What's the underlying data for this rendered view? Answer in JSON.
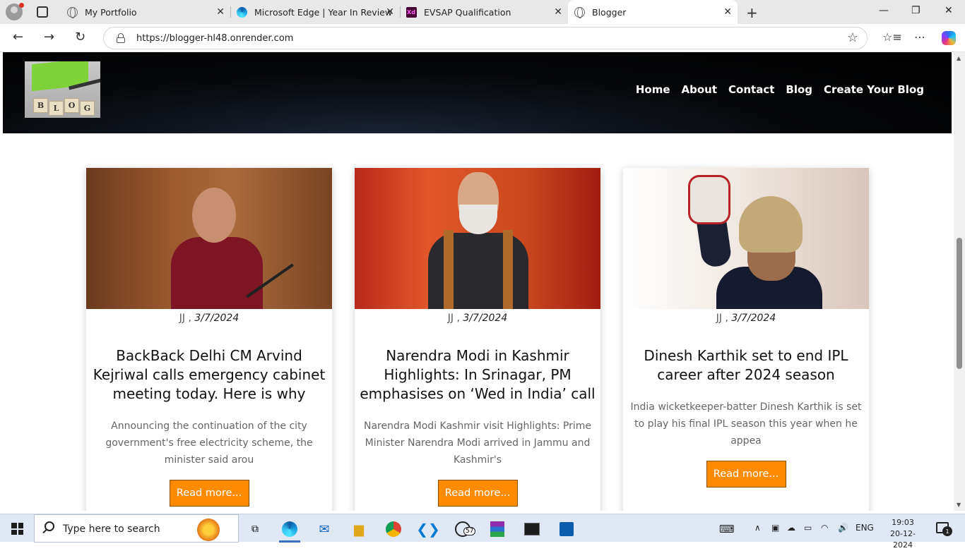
{
  "browser": {
    "tabs": [
      {
        "title": "My Portfolio",
        "icon": "globe-icon"
      },
      {
        "title": "Microsoft Edge | Year In Review",
        "icon": "edge-icon"
      },
      {
        "title": "EVSAP Qualification",
        "icon": "xd-icon",
        "icon_text": "Xd"
      },
      {
        "title": "Blogger",
        "icon": "globe-icon",
        "active": true
      }
    ],
    "url": "https://blogger-hl48.onrender.com"
  },
  "site": {
    "logo_letters": [
      "B",
      "L",
      "O",
      "G"
    ],
    "nav": [
      "Home",
      "About",
      "Contact",
      "Blog",
      "Create Your Blog"
    ]
  },
  "posts": [
    {
      "author": "JJ",
      "separator": " , ",
      "date": "3/7/2024",
      "title": "BackBack Delhi CM Arvind Kejriwal calls emergency cabinet meeting today. Here is why",
      "excerpt": "Announcing the continuation of the city government's free electricity scheme, the minister said arou",
      "button": "Read more..."
    },
    {
      "author": "JJ",
      "separator": " , ",
      "date": "3/7/2024",
      "title": "Narendra Modi in Kashmir Highlights: In Srinagar, PM emphasises on ‘Wed in India’ call",
      "excerpt": "Narendra Modi Kashmir visit Highlights: Prime Minister Narendra Modi arrived in Jammu and Kashmir's",
      "button": "Read more..."
    },
    {
      "author": "JJ",
      "separator": " , ",
      "date": "3/7/2024",
      "title": "Dinesh Karthik set to end IPL career after 2024 season",
      "excerpt": "India wicketkeeper-batter Dinesh Karthik is set to play his final IPL season this year when he appea",
      "button": "Read more..."
    }
  ],
  "taskbar": {
    "search_placeholder": "Type here to search",
    "whatsapp_badge": "57",
    "language": "ENG",
    "time": "19:03",
    "date": "20-12-2024",
    "notification_count": "1"
  }
}
